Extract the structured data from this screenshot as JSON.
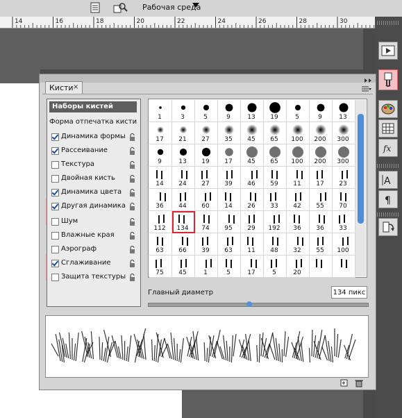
{
  "topbar": {
    "workspace_label": "Рабочая среда"
  },
  "ruler": {
    "ticks": [
      "14",
      "16",
      "18",
      "20",
      "22",
      "24",
      "26",
      "28",
      "30"
    ]
  },
  "panel": {
    "tab_label": "Кисти",
    "close_glyph": "×",
    "presets_header": "Наборы кистей",
    "brush_tip_label": "Форма отпечатка кисти",
    "options": [
      {
        "label": "Динамика формы",
        "checked": true
      },
      {
        "label": "Рассеивание",
        "checked": true
      },
      {
        "label": "Текстура",
        "checked": false
      },
      {
        "label": "Двойная кисть",
        "checked": false
      },
      {
        "label": "Динамика цвета",
        "checked": true
      },
      {
        "label": "Другая динамика",
        "checked": true
      },
      {
        "label": "Шум",
        "checked": false
      },
      {
        "label": "Влажные края",
        "checked": false
      },
      {
        "label": "Аэрограф",
        "checked": false
      },
      {
        "label": "Сглаживание",
        "checked": true
      },
      {
        "label": "Защита текстуры",
        "checked": false
      }
    ],
    "brush_sizes": [
      [
        "1",
        "3",
        "5",
        "9",
        "13",
        "19",
        "5",
        "9",
        "13"
      ],
      [
        "17",
        "21",
        "27",
        "35",
        "45",
        "65",
        "100",
        "200",
        "300"
      ],
      [
        "9",
        "13",
        "19",
        "17",
        "45",
        "65",
        "100",
        "200",
        "300"
      ],
      [
        "14",
        "24",
        "27",
        "39",
        "46",
        "59",
        "11",
        "17",
        "23"
      ],
      [
        "36",
        "44",
        "60",
        "14",
        "26",
        "33",
        "42",
        "55",
        "70"
      ],
      [
        "112",
        "134",
        "74",
        "95",
        "29",
        "192",
        "36",
        "36",
        "33"
      ],
      [
        "63",
        "66",
        "39",
        "63",
        "11",
        "48",
        "32",
        "55",
        "100"
      ],
      [
        "75",
        "45",
        "1",
        "5",
        "17",
        "5",
        "20",
        "",
        ""
      ]
    ],
    "selected_brush": "134",
    "master_diameter_label": "Главный диаметр",
    "master_diameter_value": "134 пикс",
    "slider_fraction": 0.46
  }
}
